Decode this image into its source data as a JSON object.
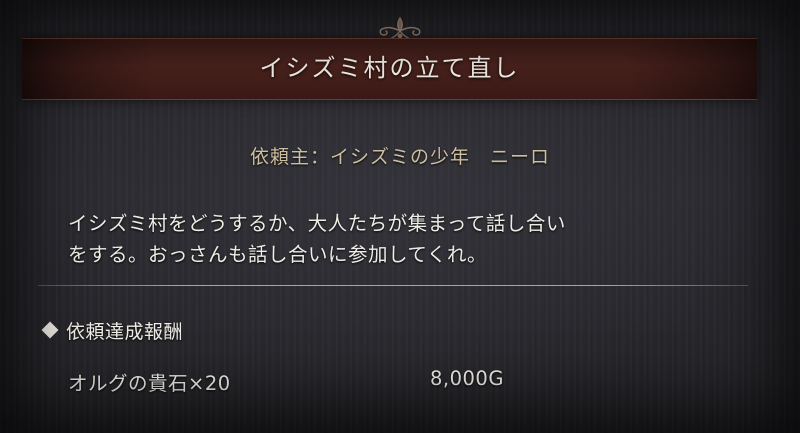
{
  "quest": {
    "title": "イシズミ村の立て直し",
    "client": "依頼主：イシズミの少年　ニーロ",
    "description": [
      "イシズミ村をどうするか、大人たちが集まって話し合い",
      "をする。おっさんも話し合いに参加してくれ。"
    ]
  },
  "rewards": {
    "header": "依頼達成報酬",
    "item": "オルグの貴石×20",
    "gold": "8,000G"
  },
  "colors": {
    "title_bar": "#4a221d",
    "title_text": "#f3eee6",
    "client_text": "#cdbf9f",
    "body_text": "#efece6"
  },
  "icons": {
    "ornament": "flourish-ornament-icon",
    "reward_bullet": "diamond-bullet-icon"
  }
}
